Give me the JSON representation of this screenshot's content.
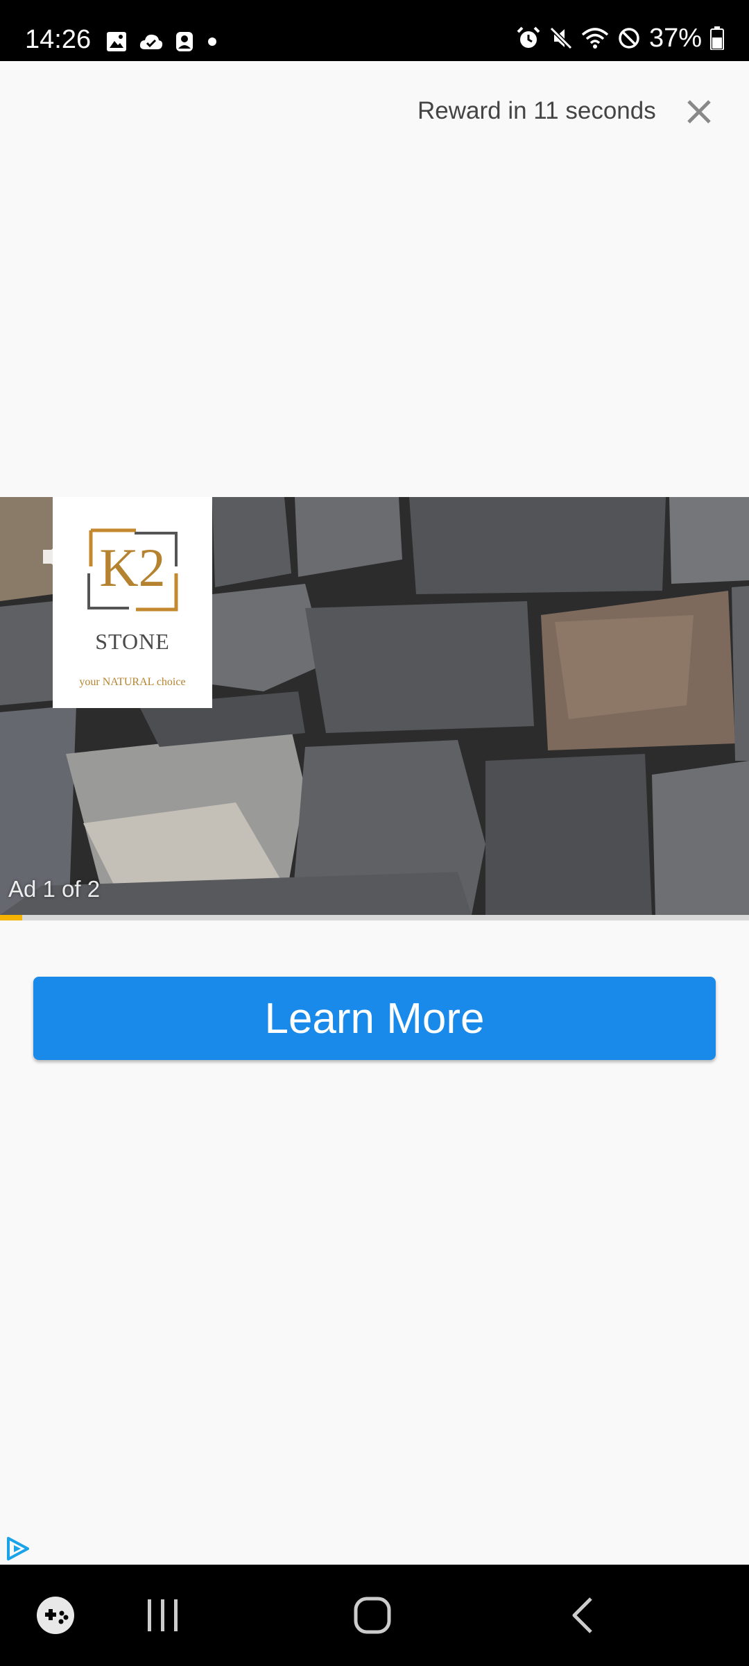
{
  "status_bar": {
    "time": "14:26",
    "battery": "37%",
    "left_icons": [
      "image-icon",
      "cloud-check-icon",
      "account-icon",
      "dot-icon"
    ],
    "right_icons": [
      "alarm-icon",
      "mute-icon",
      "wifi-icon",
      "do-not-disturb-icon",
      "battery-icon"
    ]
  },
  "reward": {
    "text": "Reward in 11 seconds",
    "close_icon": "close-icon"
  },
  "ad": {
    "brand_mark": "K2",
    "brand_name": "STONE",
    "tagline": "your NATURAL choice",
    "counter": "Ad 1 of 2",
    "progress_fraction": 0.03,
    "sound_icon": "speaker-icon"
  },
  "cta": {
    "label": "Learn More"
  },
  "adchoices": {
    "icon": "adchoices-icon"
  },
  "nav_bar": {
    "items": [
      "game-launcher-icon",
      "recent-apps-icon",
      "home-icon",
      "back-icon"
    ]
  },
  "colors": {
    "accent": "#1a8aea",
    "progress": "#f4b400",
    "logo_gold": "#b5832f"
  }
}
